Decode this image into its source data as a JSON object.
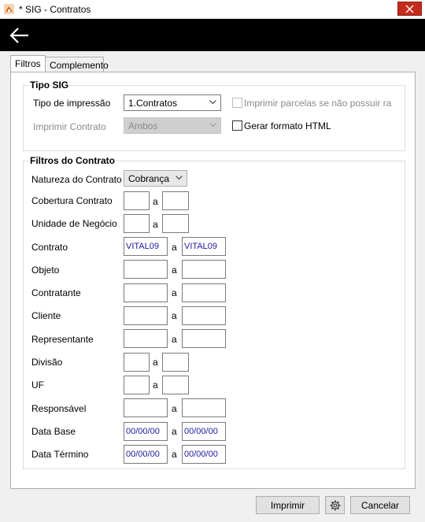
{
  "window": {
    "title": "* SIG - Contratos"
  },
  "tabs": [
    "Filtros",
    "Complemento"
  ],
  "tipo_sig": {
    "title": "Tipo SIG",
    "tipo_impressao_label": "Tipo de impressão",
    "tipo_impressao_value": "1.Contratos",
    "imprimir_contrato_label": "Imprimir Contrato",
    "imprimir_contrato_value": "Ambos",
    "imprimir_parcelas_label": "Imprimir parcelas se não possuir ra",
    "gerar_html_label": "Gerar formato HTML"
  },
  "filtros": {
    "title": "Filtros do Contrato",
    "natureza_label": "Natureza do Contrato",
    "natureza_value": "Cobrança",
    "sep": "a",
    "rows": [
      {
        "label": "Cobertura Contrato",
        "from": "",
        "to": ""
      },
      {
        "label": "Unidade de Negócio",
        "from": "",
        "to": ""
      },
      {
        "label": "Contrato",
        "from": "VITAL09",
        "to": "VITAL09"
      },
      {
        "label": "Objeto",
        "from": "",
        "to": ""
      },
      {
        "label": "Contratante",
        "from": "",
        "to": ""
      },
      {
        "label": "Cliente",
        "from": "",
        "to": ""
      },
      {
        "label": "Representante",
        "from": "",
        "to": ""
      },
      {
        "label": "Divisão",
        "from": "",
        "to": ""
      },
      {
        "label": "UF",
        "from": "",
        "to": ""
      },
      {
        "label": "Responsável",
        "from": "",
        "to": ""
      },
      {
        "label": "Data Base",
        "from": "00/00/00",
        "to": "00/00/00"
      },
      {
        "label": "Data Término",
        "from": "00/00/00",
        "to": "00/00/00"
      }
    ]
  },
  "buttons": {
    "imprimir": "Imprimir",
    "cancelar": "Cancelar"
  }
}
